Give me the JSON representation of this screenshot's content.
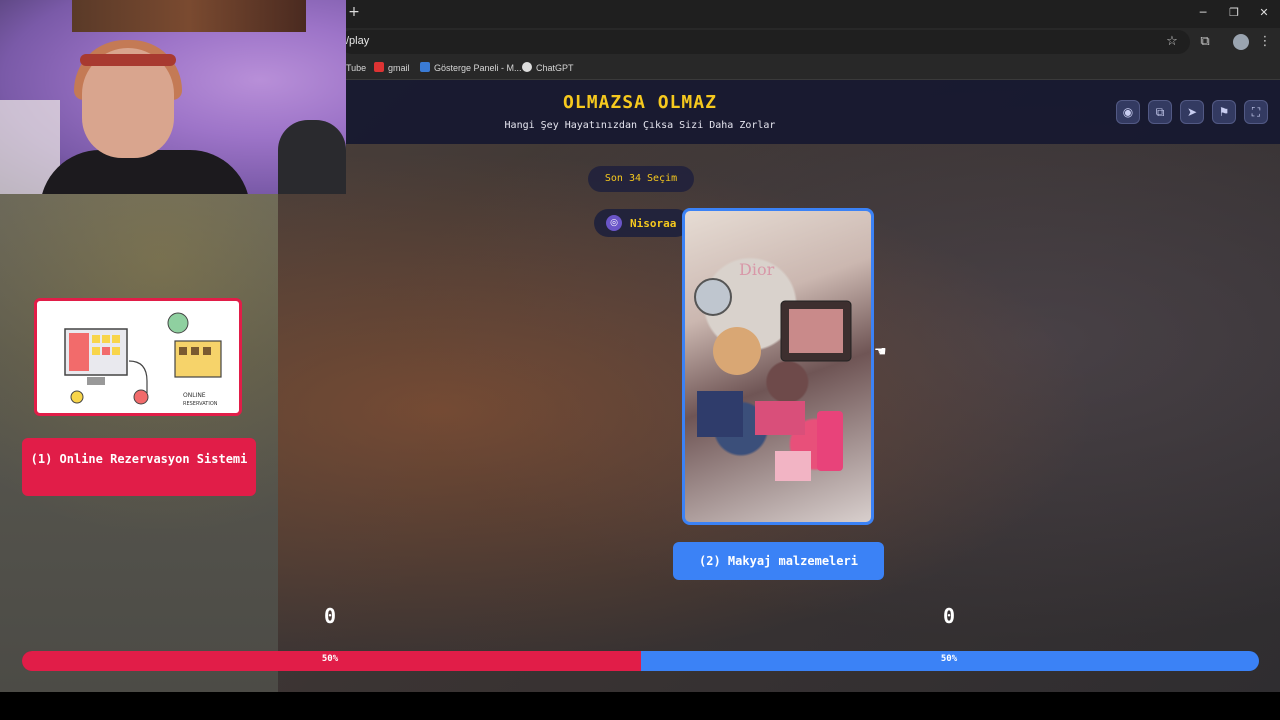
{
  "browser": {
    "address": "/play",
    "bookmarks": [
      {
        "label": "Tube",
        "icon": "youtube-icon"
      },
      {
        "label": "gmail",
        "icon": "gmail-icon"
      },
      {
        "label": "Gösterge Paneli - M...",
        "icon": "dashboard-icon"
      },
      {
        "label": "ChatGPT",
        "icon": "chatgpt-icon"
      }
    ],
    "new_tab": "+",
    "window_controls": {
      "minimize": "─",
      "restore": "❐",
      "close": "✕"
    },
    "icons": {
      "star": "☆",
      "extensions": "⧉",
      "menu": "⋮"
    }
  },
  "header": {
    "title": "OLMAZSA OLMAZ",
    "subtitle": "Hangi Şey Hayatınızdan Çıksa Sizi Daha Zorlar",
    "buttons": [
      {
        "name": "eye-icon",
        "glyph": "◉"
      },
      {
        "name": "copy-icon",
        "glyph": "⧉"
      },
      {
        "name": "send-icon",
        "glyph": "➤"
      },
      {
        "name": "flag-icon",
        "glyph": "⚑"
      },
      {
        "name": "fullscreen-icon",
        "glyph": "⛶"
      }
    ]
  },
  "game": {
    "recent_label": "Son 34 Seçim",
    "user": {
      "name": "Nisoraa",
      "avatar": "◎"
    },
    "option_left": {
      "label": "(1) Online Rezervasyon Sistemi",
      "color": "#e11d48",
      "image_text": "ONLINE RESERVATION"
    },
    "option_right": {
      "label": "(2) Makyaj malzemeleri",
      "color": "#3b82f6",
      "image_text": "Dior"
    },
    "score_left": "0",
    "score_right": "0",
    "percent_left_label": "50%",
    "percent_right_label": "50%",
    "percent_left": 50,
    "percent_right": 50
  },
  "colors": {
    "accent": "#f6c91e",
    "red": "#e11d48",
    "blue": "#3b82f6",
    "header_bg": "#16182f"
  }
}
